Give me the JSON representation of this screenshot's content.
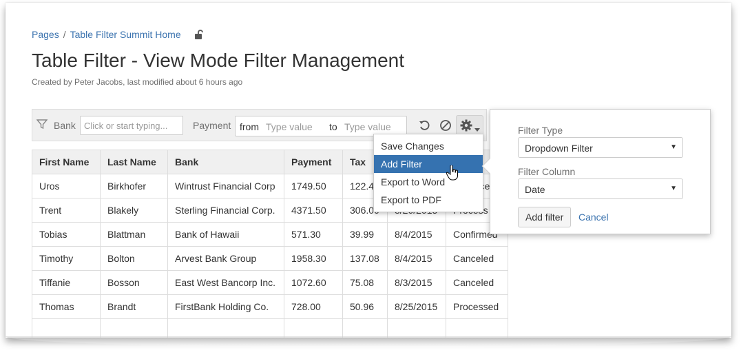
{
  "breadcrumb": {
    "root": "Pages",
    "separator": "/",
    "parent": "Table Filter Summit Home"
  },
  "page": {
    "title": "Table Filter - View Mode Filter Management",
    "meta": "Created by Peter Jacobs, last modified about 6 hours ago"
  },
  "filter_bar": {
    "bank_label": "Bank",
    "bank_placeholder": "Click or start typing...",
    "payment_label": "Payment",
    "from_label": "from",
    "from_placeholder": "Type value",
    "to_label": "to",
    "to_placeholder": "Type value",
    "icons": [
      "funnel-icon",
      "undo-icon",
      "clear-icon",
      "gear-icon",
      "caret-down-icon"
    ]
  },
  "table": {
    "headers": [
      "First Name",
      "Last Name",
      "Bank",
      "Payment",
      "Tax",
      "",
      ""
    ],
    "rows": [
      [
        "Uros",
        "Birkhofer",
        "Wintrust Financial Corp",
        "1749.50",
        "122.4",
        "",
        "ceed"
      ],
      [
        "Trent",
        "Blakely",
        "Sterling Financial Corp.",
        "4371.50",
        "306.00",
        "8/20/2015",
        "Process"
      ],
      [
        "Tobias",
        "Blattman",
        "Bank of Hawaii",
        "571.30",
        "39.99",
        "8/4/2015",
        "Confirmed"
      ],
      [
        "Timothy",
        "Bolton",
        "Arvest Bank Group",
        "1958.30",
        "137.08",
        "8/4/2015",
        "Canceled"
      ],
      [
        "Tiffanie",
        "Bosson",
        "East West Bancorp Inc.",
        "1072.60",
        "75.08",
        "8/3/2015",
        "Canceled"
      ],
      [
        "Thomas",
        "Brandt",
        "FirstBank Holding Co.",
        "728.00",
        "50.96",
        "8/25/2015",
        "Processed"
      ],
      [
        "",
        "",
        "",
        "",
        "",
        "",
        ""
      ]
    ]
  },
  "menu": {
    "items": [
      "Save Changes",
      "Add Filter",
      "Export to Word",
      "Export to PDF"
    ],
    "active_index": 1
  },
  "panel": {
    "type_label": "Filter Type",
    "type_value": "Dropdown Filter",
    "column_label": "Filter Column",
    "column_value": "Date",
    "add_button": "Add filter",
    "cancel_link": "Cancel"
  },
  "colors": {
    "link": "#3b73af",
    "active": "#3572b0"
  }
}
